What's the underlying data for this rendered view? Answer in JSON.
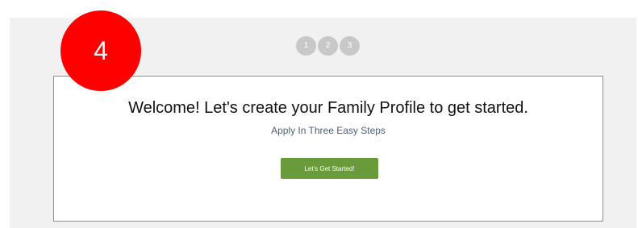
{
  "annotation": {
    "badge_number": "4"
  },
  "stepper": {
    "steps": [
      "1",
      "2",
      "3"
    ]
  },
  "welcome_card": {
    "headline": "Welcome! Let's create your Family Profile to get started.",
    "subtitle": "Apply In Three Easy Steps",
    "start_button_label": "Let's Get Started!"
  },
  "colors": {
    "badge": "#ff0000",
    "button": "#6a9b3a",
    "step_circle": "#c8c8c8",
    "panel_background": "#f1f1f1",
    "card_border": "#8e8e8e",
    "subtitle_text": "#4b5f75"
  }
}
